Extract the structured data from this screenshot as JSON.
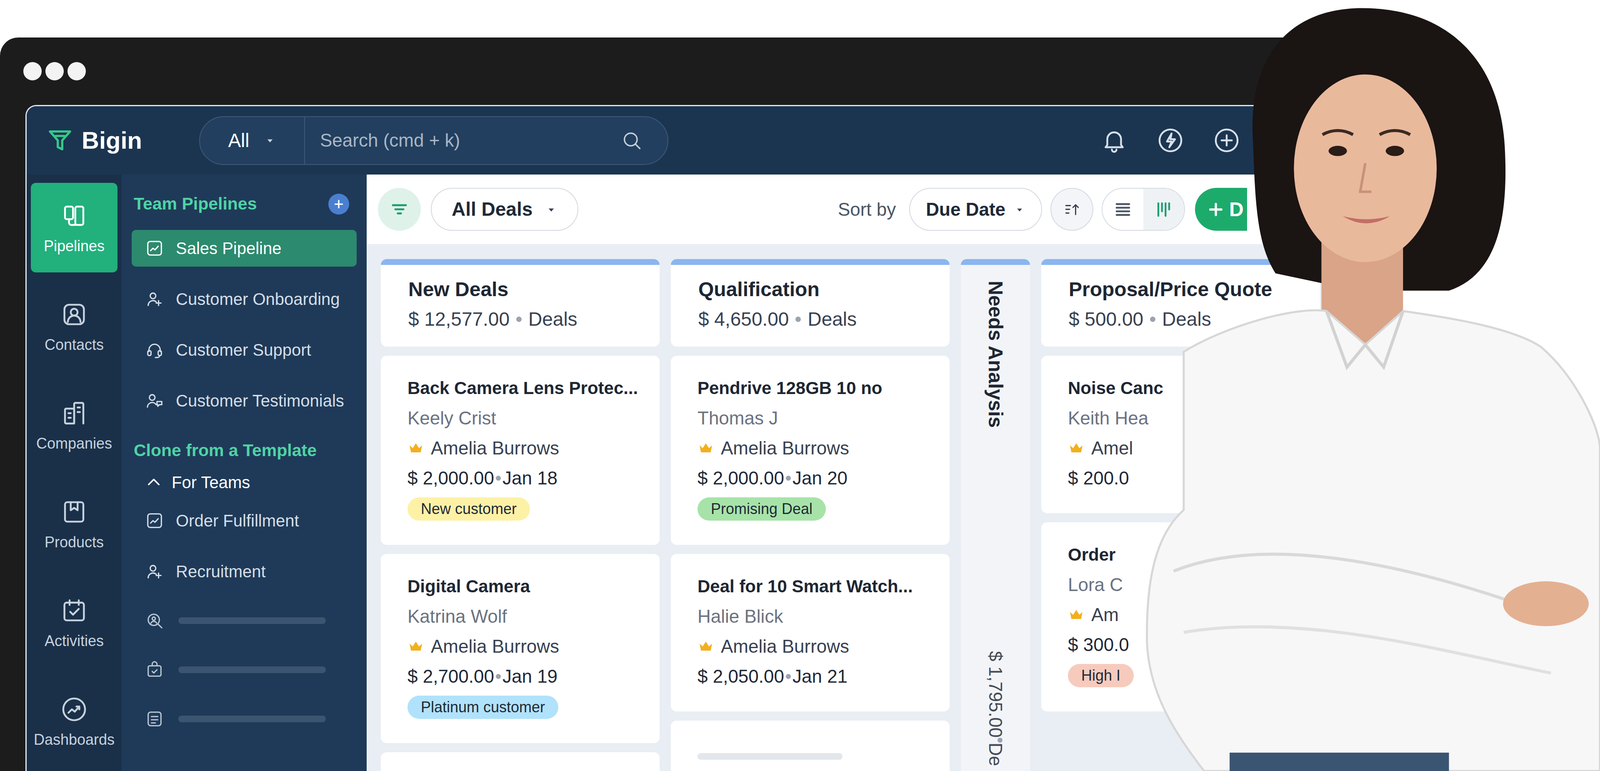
{
  "app": {
    "name": "Bigin"
  },
  "topbar": {
    "scope": "All",
    "search_placeholder": "Search (cmd + k)"
  },
  "rail": [
    {
      "label": "Pipelines",
      "selected": true
    },
    {
      "label": "Contacts",
      "selected": false
    },
    {
      "label": "Companies",
      "selected": false
    },
    {
      "label": "Products",
      "selected": false
    },
    {
      "label": "Activities",
      "selected": false
    },
    {
      "label": "Dashboards",
      "selected": false
    }
  ],
  "sidebar": {
    "team_header": "Team Pipelines",
    "team_items": [
      {
        "label": "Sales Pipeline",
        "selected": true
      },
      {
        "label": "Customer Onboarding",
        "selected": false
      },
      {
        "label": "Customer Support",
        "selected": false
      },
      {
        "label": "Customer Testimonials",
        "selected": false
      }
    ],
    "template_header": "Clone from a Template",
    "group": {
      "label": "For Teams",
      "expanded": true
    },
    "template_items": [
      {
        "label": "Order Fulfillment",
        "selected": false
      },
      {
        "label": "Recruitment",
        "selected": false
      }
    ]
  },
  "toolbar": {
    "view": "All Deals",
    "sort_label": "Sort by",
    "sort_field": "Due Date",
    "views": [
      {
        "kind": "list",
        "selected": false
      },
      {
        "kind": "kanban",
        "selected": true
      }
    ],
    "create_button": "D"
  },
  "columns": [
    {
      "kind": "expanded",
      "title": "New Deals",
      "amount": "$ 12,577.00",
      "unit": "Deals",
      "cards": [
        {
          "kind": "deal",
          "title": "Back Camera Lens Protec...",
          "contact": "Keely Crist",
          "owner": "Amelia Burrows",
          "amount": "$ 2,000.00",
          "date": "Jan 18",
          "tag": {
            "label": "New customer",
            "color": "#fdf1a6"
          }
        },
        {
          "kind": "deal",
          "title": "Digital Camera",
          "contact": "Katrina Wolf",
          "owner": "Amelia Burrows",
          "amount": "$ 2,700.00",
          "date": "Jan 19",
          "tag": {
            "label": "Platinum customer",
            "color": "#b1e2fb"
          }
        },
        {
          "kind": "partial"
        }
      ]
    },
    {
      "kind": "expanded",
      "title": "Qualification",
      "amount": "$ 4,650.00",
      "unit": "Deals",
      "cards": [
        {
          "kind": "deal",
          "title": "Pendrive 128GB 10 no",
          "contact": "Thomas J",
          "owner": "Amelia Burrows",
          "amount": "$ 2,000.00",
          "date": "Jan 20",
          "tag": {
            "label": "Promising Deal",
            "color": "#a7e3a9"
          }
        },
        {
          "kind": "deal",
          "title": "Deal for 10 Smart Watch...",
          "contact": "Halie Blick",
          "owner": "Amelia Burrows",
          "amount": "$ 2,050.00",
          "date": "Jan 21"
        },
        {
          "kind": "partial"
        }
      ]
    },
    {
      "kind": "collapsed",
      "title": "Needs Analysis",
      "amount": "$ 1,795.00",
      "unit": "De"
    },
    {
      "kind": "expanded",
      "title": "Proposal/Price Quote",
      "amount": "$ 500.00",
      "unit": "Deals",
      "cards": [
        {
          "kind": "deal",
          "title": "Noise Canc",
          "contact": "Keith Hea",
          "owner": "Amel",
          "amount": "$ 200.0"
        },
        {
          "kind": "deal",
          "title": "Order",
          "contact": "Lora C",
          "owner": "Am",
          "amount": "$ 300.0",
          "tag": {
            "label": "High I",
            "color": "#f6cbbd"
          }
        }
      ]
    }
  ]
}
